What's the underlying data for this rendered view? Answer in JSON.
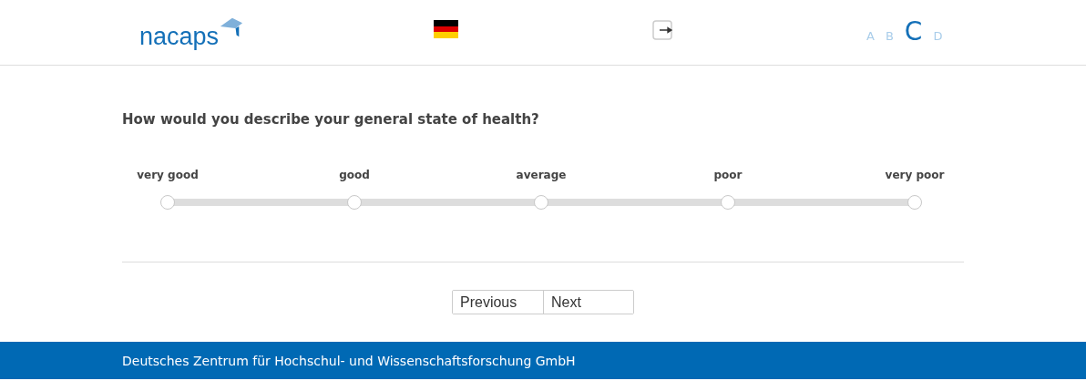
{
  "header": {
    "logo": "nacaps",
    "font_sizes": [
      {
        "label": "A",
        "selected": false
      },
      {
        "label": "B",
        "selected": false
      },
      {
        "label": "C",
        "selected": true
      },
      {
        "label": "D",
        "selected": false
      }
    ]
  },
  "question": "How would you describe your general state of health?",
  "options": [
    {
      "label": "very good",
      "selected": false
    },
    {
      "label": "good",
      "selected": false
    },
    {
      "label": "average",
      "selected": false
    },
    {
      "label": "poor",
      "selected": false
    },
    {
      "label": "very poor",
      "selected": false
    }
  ],
  "buttons": [
    "Previous",
    "Next"
  ],
  "footer": "Deutsches Zentrum für Hochschul- und Wissenschaftsforschung GmbH"
}
